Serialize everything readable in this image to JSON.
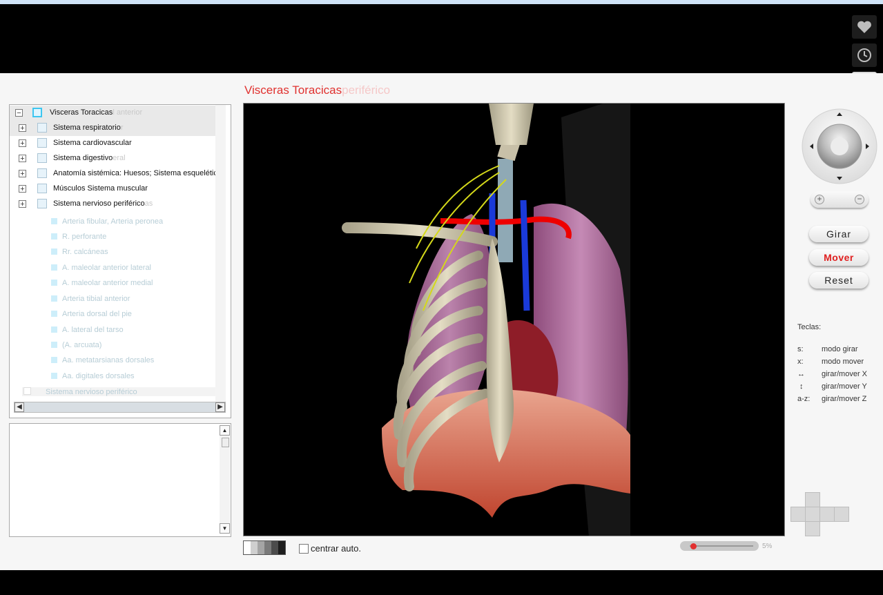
{
  "header": {
    "icons": [
      "heart-icon",
      "clock-icon",
      "send-icon"
    ]
  },
  "title": {
    "main": "Visceras Toracicas",
    "ghost": "periférico"
  },
  "tree": {
    "root_label": "Visceras Toracicas",
    "root_ghost": "l anterior",
    "items": [
      {
        "label": "Sistema respiratorio",
        "ghost": "r"
      },
      {
        "label": "Sistema cardiovascular",
        "ghost": ""
      },
      {
        "label": "Sistema digestivo",
        "ghost": "eral"
      },
      {
        "label": "Anatomía sistémica: Huesos; Sistema esquelético",
        "ghost": ""
      },
      {
        "label": "Músculos Sistema muscular",
        "ghost": ""
      },
      {
        "label": "Sistema nervioso periférico",
        "ghost": "as"
      }
    ],
    "ghost_items": [
      "Arteria fibular, Arteria peronea",
      "R. perforante",
      "Rr. calcáneas",
      "A. maleolar anterior lateral",
      "A. maleolar anterior medial",
      "Arteria tibial anterior",
      "Arteria dorsal del pie",
      "A. lateral del tarso",
      "(A. arcuata)",
      "Aa. metatarsianas dorsales",
      "Aa. digitales dorsales"
    ],
    "ghost_bottom": "Sistema nervioso periférico"
  },
  "viewer": {
    "description": "3D thoracic viscera model"
  },
  "controls": {
    "center_auto_label": "centrar auto.",
    "slider_value": "5%",
    "slider_fraction": 0.05,
    "swatch_colors": [
      "#ffffff",
      "#cfcfcf",
      "#a5a5a5",
      "#7a7a7a",
      "#4c4c4c",
      "#1e1e1e"
    ]
  },
  "mode_buttons": {
    "girar": "Girar",
    "mover": "Mover",
    "reset": "Reset",
    "active": "Mover"
  },
  "keys": {
    "heading": "Teclas:",
    "rows": [
      {
        "key": "s:",
        "desc": "modo girar"
      },
      {
        "key": "x:",
        "desc": "modo mover"
      },
      {
        "key": "↔",
        "desc": "girar/mover X"
      },
      {
        "key": "↕",
        "desc": "girar/mover Y"
      },
      {
        "key": "a-z:",
        "desc": "girar/mover Z"
      }
    ]
  },
  "colors": {
    "accent_red": "#e0312f",
    "selected_checkbox": "#3ec6f0"
  }
}
